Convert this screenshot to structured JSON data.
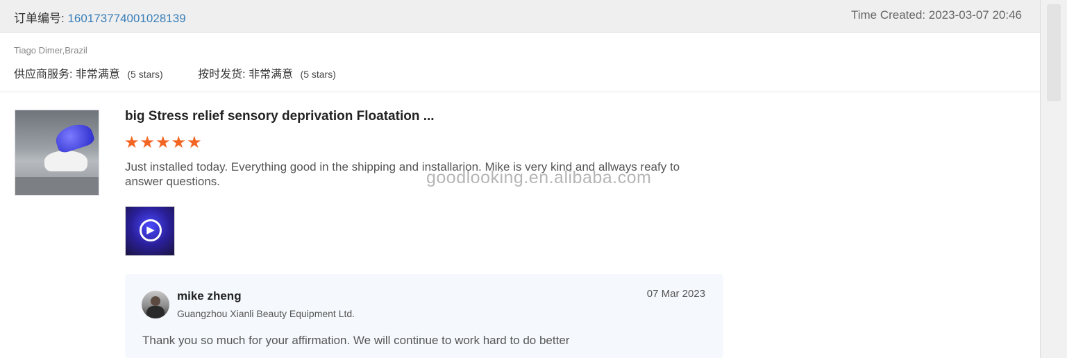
{
  "order": {
    "label": "订单编号:",
    "number": "160173774001028139",
    "time_created": "Time Created: 2023-03-07 20:46"
  },
  "buyer": {
    "name_location": "Tiago Dimer,Brazil",
    "ratings": [
      {
        "label": "供应商服务:",
        "value": "非常满意",
        "stars_note": "(5 stars)"
      },
      {
        "label": "按时发货:",
        "value": "非常满意",
        "stars_note": "(5 stars)"
      }
    ]
  },
  "product": {
    "title": "big Stress relief sensory deprivation Floatation ...",
    "rating_stars": 5,
    "star_glyphs": "★★★★★",
    "star_color": "#f26522",
    "review": "Just installed today. Everything good in the shipping and installarion. Mike is very kind and allways reafy to answer questions.",
    "video_icon": "play-circle-icon"
  },
  "watermark": "goodlooking.en.alibaba.com",
  "reply": {
    "name": "mike zheng",
    "company": "Guangzhou Xianli Beauty Equipment Ltd.",
    "date": "07 Mar 2023",
    "text": "Thank you so much for your affirmation. We will continue to work hard to do better"
  },
  "colors": {
    "order_number": "#3a7fb9",
    "header_bg": "#efefef",
    "reply_bg": "#f5f8fc"
  }
}
